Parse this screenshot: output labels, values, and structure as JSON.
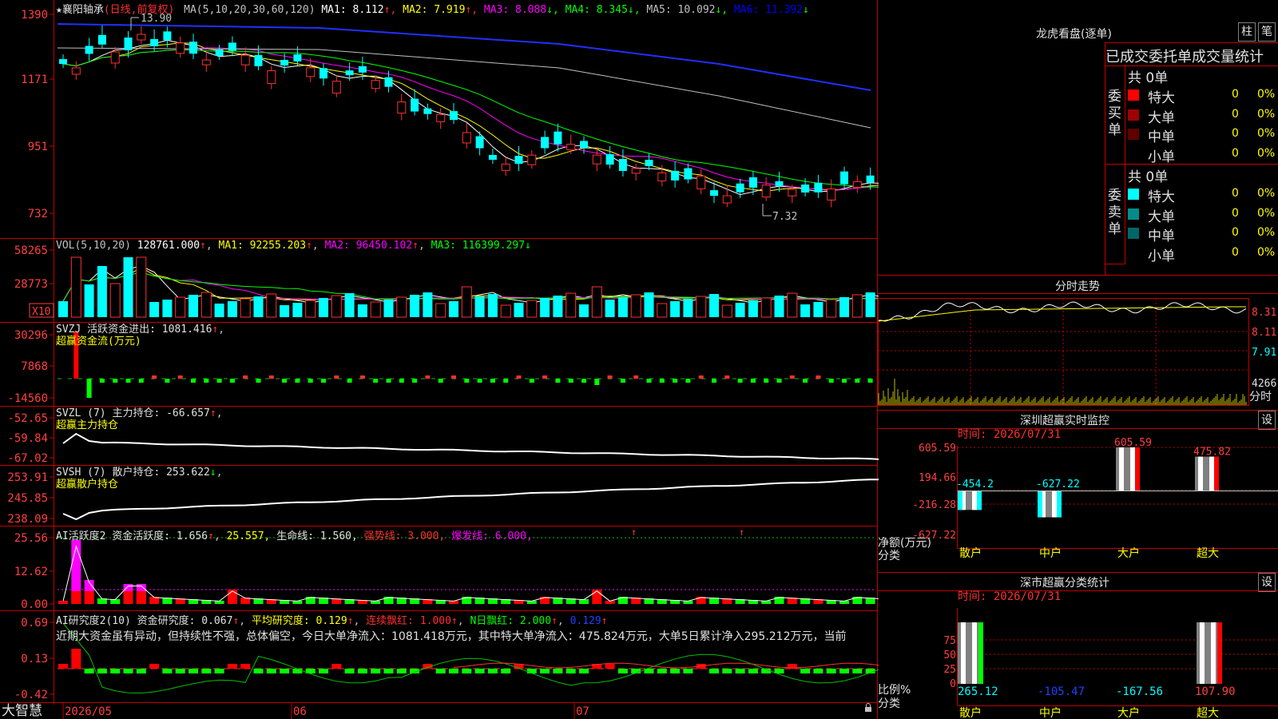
{
  "stock": {
    "star": "★",
    "name": "襄阳轴承",
    "period": "(日线,前复权)"
  },
  "main_chart": {
    "ma_label": "MA(5,10,20,30,60,120)",
    "indicators": [
      {
        "text": "MA1: 8.112",
        "arrow": "↑",
        "color": "#ffffff",
        "arrow_color": "#ff3030"
      },
      {
        "text": "MA2: 7.919",
        "arrow": "↑",
        "color": "#ffff00",
        "arrow_color": "#ff3030"
      },
      {
        "text": "MA3: 8.088",
        "arrow": "↓",
        "color": "#ff00ff",
        "arrow_color": "#00ff00"
      },
      {
        "text": "MA4: 8.345",
        "arrow": "↓",
        "color": "#00ff00",
        "arrow_color": "#00ff00"
      },
      {
        "text": "MA5: 10.092",
        "arrow": "↓",
        "color": "#c0c0c0",
        "arrow_color": "#00ff00"
      },
      {
        "text": "MA6: 11.392",
        "arrow": "↓",
        "color": "#0000ff",
        "arrow_color": "#00ff00"
      }
    ],
    "yticks": [
      "1390",
      "1171",
      "951",
      "732"
    ],
    "high_label": "13.90",
    "low_label": "7.32"
  },
  "vol_panel": {
    "title": "VOL(5,10,20)",
    "value": "128761.000",
    "ma1": "MA1: 92255.203",
    "ma2": "MA2: 96450.102",
    "ma3": "MA3: 116399.297",
    "yticks": [
      "58265",
      "28773"
    ],
    "unit": "X10"
  },
  "svzj_panel": {
    "line1": "SVZJ  活跃资金进出: 1081.416",
    "line2": "超赢资金流(万元)",
    "yticks": [
      "30296",
      "7868",
      "-14560"
    ]
  },
  "svzl_panel": {
    "line1": "SVZL (7) 主力持仓: -66.657",
    "line2": "超赢主力持仓",
    "yticks": [
      "-52.65",
      "-59.84",
      "-67.02"
    ]
  },
  "svsh_panel": {
    "line1": "SVSH (7) 散户持仓: 253.622",
    "line2": "超赢散户持仓",
    "yticks": [
      "253.91",
      "245.85",
      "238.09"
    ]
  },
  "ai_active_panel": {
    "prefix": "AI活跃度2 资金活跃度: 1.656",
    "v2": "25.557,",
    "v3": "生命线: 1.560,",
    "v4": "强势线: 3.000,",
    "v5": "爆发线: 6.000,",
    "yticks": [
      "25.56",
      "12.62",
      "0.00"
    ]
  },
  "ai_research_panel": {
    "prefix": "AI研究度2(10) 资金研究度: 0.067",
    "v2": "平均研究度: 0.129",
    "v3": "连续飘红: 1.000",
    "v4": "N日飘红: 2.000",
    "v5": "0.129",
    "note": "近期大资金虽有异动，但持续性不强，总体偏空，今日大单净流入：1081.418万元，其中特大单净流入：475.824万元，大单5日累计净入295.212万元，当前",
    "yticks": [
      "0.69",
      "0.13",
      "-0.42"
    ]
  },
  "footer": {
    "brand": "大智慧",
    "dates": [
      "2026/05",
      "06",
      "07"
    ]
  },
  "dragon_tiger": {
    "title": "龙虎看盘(逐单)",
    "btn_pillar": "柱",
    "btn_pen": "笔",
    "header": "已成交委托单成交量统计",
    "buy_group": {
      "label": "委买单",
      "total": "共 0单",
      "rows": [
        {
          "name": "特大",
          "count": "0",
          "pct": "0%",
          "color": "#ff0000"
        },
        {
          "name": "大单",
          "count": "0",
          "pct": "0%",
          "color": "#a00000"
        },
        {
          "name": "中单",
          "count": "0",
          "pct": "0%",
          "color": "#600000"
        },
        {
          "name": "小单",
          "count": "0",
          "pct": "0%",
          "color": "#000000"
        }
      ]
    },
    "sell_group": {
      "label": "委卖单",
      "total": "共 0单",
      "rows": [
        {
          "name": "特大",
          "count": "0",
          "pct": "0%",
          "color": "#00ffff"
        },
        {
          "name": "大单",
          "count": "0",
          "pct": "0%",
          "color": "#008c8c"
        },
        {
          "name": "中单",
          "count": "0",
          "pct": "0%",
          "color": "#006666"
        },
        {
          "name": "小单",
          "count": "0",
          "pct": "0%",
          "color": "#000000"
        }
      ]
    }
  },
  "intraday": {
    "title": "分时走势",
    "yticks": [
      "8.31",
      "8.11",
      "7.91"
    ],
    "vol_label": "4266",
    "tag": "分时"
  },
  "sz_monitor": {
    "title": "深圳超赢实时监控",
    "btn": "设",
    "time": "时间: 2026/07/31",
    "yticks": [
      "605.59",
      "194.66",
      "-216.28",
      "-627.22"
    ],
    "axis_label": "净额(万元)",
    "cat_label": "分类",
    "bars": [
      {
        "name": "散户",
        "value": -454.2,
        "label": "-454.2"
      },
      {
        "name": "中户",
        "value": -627.22,
        "label": "-627.22"
      },
      {
        "name": "大户",
        "value": 605.59,
        "label": "605.59"
      },
      {
        "name": "超大",
        "value": 475.82,
        "label": "475.82"
      }
    ]
  },
  "sz_category": {
    "title": "深市超赢分类统计",
    "btn": "设",
    "time": "时间: 2026/07/31",
    "yticks": [
      "75",
      "50",
      "25",
      "0"
    ],
    "axis_label": "比例%",
    "cat_label": "分类",
    "values": [
      {
        "name": "散户",
        "label": "265.12",
        "color": "#00ffff"
      },
      {
        "name": "中户",
        "label": "-105.47",
        "color": "#2040ff"
      },
      {
        "name": "大户",
        "label": "-167.56",
        "color": "#00ffff"
      },
      {
        "name": "超大",
        "label": "107.90",
        "color": "#ff4040"
      }
    ]
  }
}
